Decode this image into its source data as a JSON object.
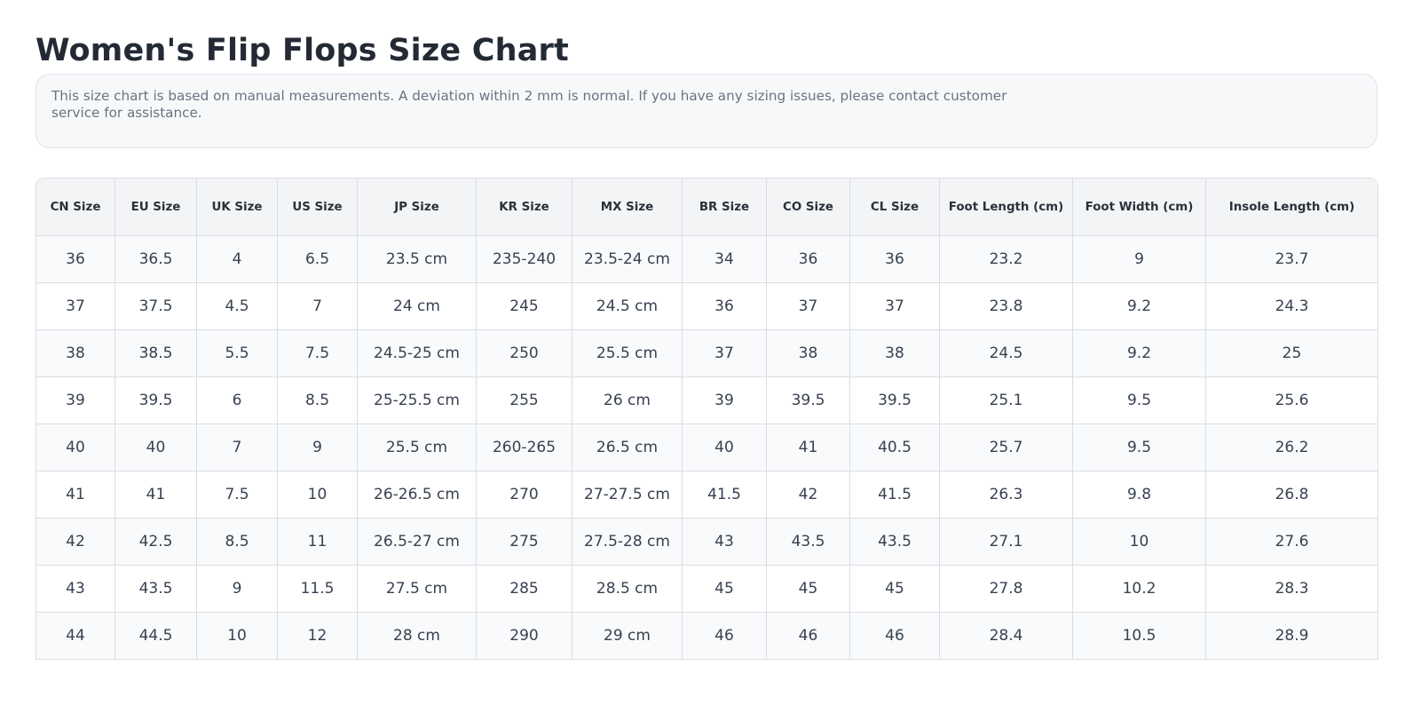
{
  "title": "Women's Flip Flops Size Chart",
  "note": "This size chart is based on manual measurements. A deviation within 2 mm is normal. If you have any sizing issues, please contact customer service for assistance.",
  "table": {
    "headers": [
      "CN Size",
      "EU Size",
      "UK Size",
      "US Size",
      "JP Size",
      "KR Size",
      "MX Size",
      "BR Size",
      "CO Size",
      "CL Size",
      "Foot Length (cm)",
      "Foot Width (cm)",
      "Insole Length (cm)"
    ],
    "rows": [
      [
        "36",
        "36.5",
        "4",
        "6.5",
        "23.5 cm",
        "235-240",
        "23.5-24 cm",
        "34",
        "36",
        "36",
        "23.2",
        "9",
        "23.7"
      ],
      [
        "37",
        "37.5",
        "4.5",
        "7",
        "24 cm",
        "245",
        "24.5 cm",
        "36",
        "37",
        "37",
        "23.8",
        "9.2",
        "24.3"
      ],
      [
        "38",
        "38.5",
        "5.5",
        "7.5",
        "24.5-25 cm",
        "250",
        "25.5 cm",
        "37",
        "38",
        "38",
        "24.5",
        "9.2",
        "25"
      ],
      [
        "39",
        "39.5",
        "6",
        "8.5",
        "25-25.5 cm",
        "255",
        "26 cm",
        "39",
        "39.5",
        "39.5",
        "25.1",
        "9.5",
        "25.6"
      ],
      [
        "40",
        "40",
        "7",
        "9",
        "25.5 cm",
        "260-265",
        "26.5 cm",
        "40",
        "41",
        "40.5",
        "25.7",
        "9.5",
        "26.2"
      ],
      [
        "41",
        "41",
        "7.5",
        "10",
        "26-26.5 cm",
        "270",
        "27-27.5 cm",
        "41.5",
        "42",
        "41.5",
        "26.3",
        "9.8",
        "26.8"
      ],
      [
        "42",
        "42.5",
        "8.5",
        "11",
        "26.5-27 cm",
        "275",
        "27.5-28 cm",
        "43",
        "43.5",
        "43.5",
        "27.1",
        "10",
        "27.6"
      ],
      [
        "43",
        "43.5",
        "9",
        "11.5",
        "27.5 cm",
        "285",
        "28.5 cm",
        "45",
        "45",
        "45",
        "27.8",
        "10.2",
        "28.3"
      ],
      [
        "44",
        "44.5",
        "10",
        "12",
        "28 cm",
        "290",
        "29 cm",
        "46",
        "46",
        "46",
        "28.4",
        "10.5",
        "28.9"
      ]
    ]
  }
}
